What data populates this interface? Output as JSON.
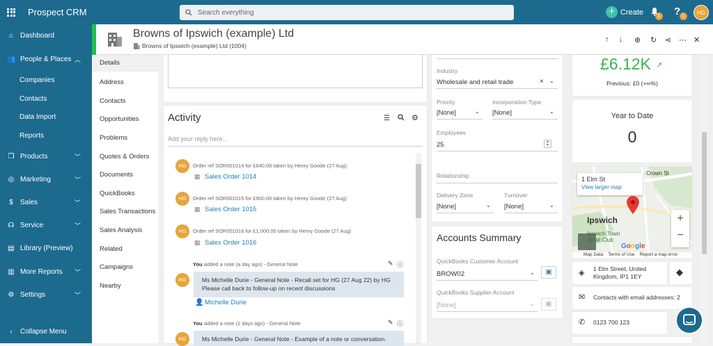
{
  "app": {
    "name": "Prospect CRM",
    "search_placeholder": "Search everything",
    "create_label": "Create",
    "notif_count": "1",
    "help_count": "1",
    "user_initials": "HG"
  },
  "sidebar": {
    "dashboard": "Dashboard",
    "people_places": "People & Places",
    "companies": "Companies",
    "contacts": "Contacts",
    "data_import": "Data Import",
    "reports": "Reports",
    "products": "Products",
    "marketing": "Marketing",
    "sales": "Sales",
    "service": "Service",
    "library": "Library (Preview)",
    "more_reports": "More Reports",
    "settings": "Settings",
    "collapse": "Collapse Menu"
  },
  "record": {
    "title": "Browns of Ipswich (example) Ltd",
    "subtitle": "Browns of Ipswich (example) Ltd",
    "id": "(1004)"
  },
  "subnav": [
    "Details",
    "Address",
    "Contacts",
    "Opportunities",
    "Problems",
    "Quotes & Orders",
    "Documents",
    "QuickBooks",
    "Sales Transactions",
    "Sales Analysis",
    "Related",
    "Campaigns",
    "Nearby"
  ],
  "activity": {
    "title": "Activity",
    "reply_placeholder": "Add your reply here...",
    "items": [
      {
        "initials": "HG",
        "text": "Order ref SOR001014 for £640.00 taken by Henry Goode",
        "date": "(27 Aug)",
        "link": "Sales Order 1014"
      },
      {
        "initials": "HG",
        "text": "Order ref SOR001015 for £900.00 taken by Henry Goode",
        "date": "(27 Aug)",
        "link": "Sales Order 1015"
      },
      {
        "initials": "HG",
        "text": "Order ref SOR001016 for £1,000.00 taken by Henry Goode",
        "date": "(27 Aug)",
        "link": "Sales Order 1016"
      }
    ],
    "note1_header_you": "You",
    "note1_header_rest": "added a note (a day ago) - General Note",
    "note1_text": "Ms Michelle Durie - General Note - Recall set for HG (27 Aug 22) by HG Please call back to follow-up on recent discussions",
    "note1_contact": "Michelle Durie",
    "note2_header_you": "You",
    "note2_header_rest": "added a note (2 days ago) - General Note",
    "note2_text": "Ms Michelle Durie - General Note - Example of a note or conversation.",
    "note_initials": "HG"
  },
  "details": {
    "industry_label": "Industry",
    "industry_value": "Wholesale and retail trade",
    "priority_label": "Priority",
    "priority_value": "[None]",
    "incorp_label": "Incorporation Type",
    "incorp_value": "[None]",
    "employees_label": "Employees",
    "employees_value": "25",
    "relationship_label": "Relationship",
    "delivery_label": "Delivery Zone",
    "delivery_value": "[None]",
    "turnover_label": "Turnover",
    "turnover_value": "[None]"
  },
  "accounts": {
    "title": "Accounts Summary",
    "customer_label": "QuickBooks Customer Account",
    "customer_value": "BROW02",
    "supplier_label": "QuickBooks Supplier Account",
    "supplier_value": "[None]"
  },
  "stats": {
    "amount": "£6.12K",
    "previous": "Previous: £0 (+∞%)",
    "ytd_label": "Year to Date",
    "ytd_value": "0"
  },
  "map": {
    "place": "1 Elm St",
    "view_larger": "View larger map",
    "town": "Ipswich",
    "street": "Crown St",
    "club1": "Ipswich Town",
    "club2": "otball Club",
    "google": "Google",
    "footer1": "Map Data",
    "footer2": "Terms of Use",
    "footer3": "Report a map error"
  },
  "contact_info": {
    "address": "1 Elm Street, United Kingdom, IP1 1EY",
    "email": "Contacts with email addresses: 2",
    "phone": "0123 700 123"
  },
  "colors": {
    "brand": "#1d6a8f",
    "accent": "#3cc3a8",
    "avatar": "#e8a43a",
    "green": "#39b54a"
  }
}
